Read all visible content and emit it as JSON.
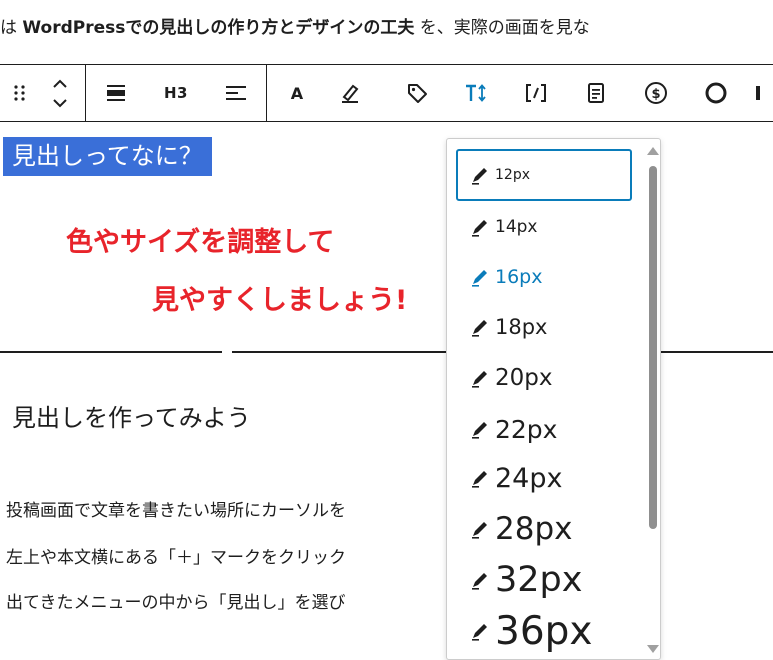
{
  "intro": {
    "prefix": "は ",
    "bold": "WordPressでの見出しの作り方とデザインの工夫",
    "suffix": " を、実際の画面を見な"
  },
  "toolbar": {
    "heading_level": "H3",
    "text_color_label": "A"
  },
  "content": {
    "heading": "見出しってなに？",
    "banner_line1": "色やサイズを調整して",
    "banner_line2": "見やすくしましょう!",
    "subheading": "見出しを作ってみよう",
    "paragraphs": [
      "投稿画面で文章を書きたい場所にカーソルを",
      "左上や本文横にある「＋」マークをクリック",
      "出てきたメニューの中から「見出し」を選び"
    ]
  },
  "font_size_dropdown": {
    "options": [
      "12px",
      "14px",
      "16px",
      "18px",
      "20px",
      "22px",
      "24px",
      "28px",
      "32px",
      "36px"
    ],
    "focused": "12px",
    "selected": "16px"
  },
  "colors": {
    "accent": "#0a7cba",
    "selection": "#3a6fd8",
    "banner_red": "#e8242b"
  }
}
